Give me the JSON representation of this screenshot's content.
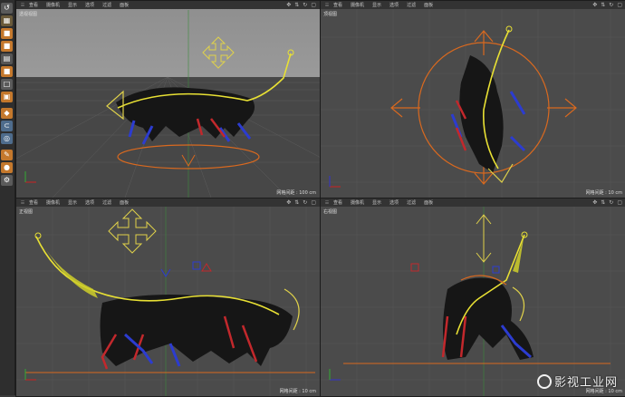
{
  "viewport_menu": [
    "查看",
    "摄像机",
    "显示",
    "选项",
    "过滤",
    "面板"
  ],
  "viewports": [
    {
      "title": "透视视图",
      "info": "网格间距 : 100 cm"
    },
    {
      "title": "顶视图",
      "info": "网格间距 : 10 cm"
    },
    {
      "title": "正视图",
      "info": "网格间距 : 10 cm"
    },
    {
      "title": "右视图",
      "info": "网格间距 : 10 cm"
    }
  ],
  "watermark": "影视工业网",
  "colors": {
    "gizmo": "#e0d24a",
    "skeleton": "#e8e034",
    "circle": "#d9691f",
    "blue_part": "#2a3fd0",
    "red_part": "#c8242c",
    "grid_bg": "#4b4b4b"
  }
}
